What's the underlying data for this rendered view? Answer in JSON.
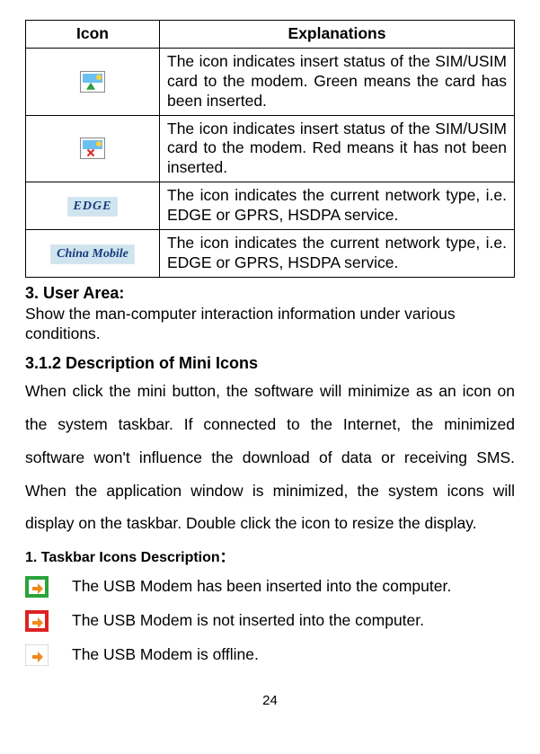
{
  "table": {
    "head_icon": "Icon",
    "head_exp": "Explanations",
    "rows": [
      {
        "exp": "The icon indicates insert status of the SIM/USIM card to the modem. Green means the card has been inserted."
      },
      {
        "exp": "The icon indicates insert status of the SIM/USIM card to the modem. Red means it has not been inserted."
      },
      {
        "exp": "The icon indicates the current network type, i.e. EDGE or GPRS, HSDPA service."
      },
      {
        "exp": "The icon indicates the current network type, i.e. EDGE or GPRS, HSDPA service."
      }
    ],
    "edge_label": "EDGE",
    "carrier_label": "China Mobile"
  },
  "section3": {
    "heading": "3. User Area:",
    "text": "Show the man-computer interaction information under various conditions."
  },
  "section312": {
    "heading": "3.1.2 Description of Mini Icons",
    "text": "When click the mini button, the software will minimize as an icon on the system taskbar. If connected to the Internet, the minimized software won't influence the download of data or receiving SMS. When the application window is minimized, the system icons will display on the taskbar. Double click the icon to resize the display."
  },
  "taskbar": {
    "heading": "1.   Taskbar Icons Description：",
    "items": [
      "The USB Modem has been inserted into the computer.",
      "The USB Modem is not inserted into the computer.",
      "The USB Modem is offline."
    ]
  },
  "page_number": "24"
}
